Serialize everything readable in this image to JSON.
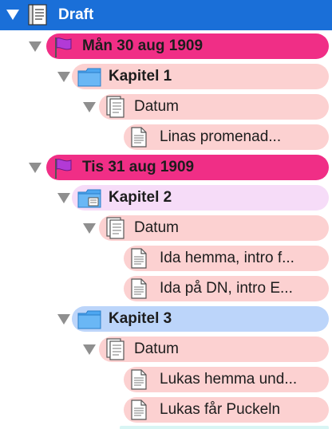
{
  "outline": {
    "root": {
      "label": "Draft"
    },
    "items": [
      {
        "label": "Mån 30 aug 1909",
        "kind": "day"
      },
      {
        "label": "Kapitel 1",
        "kind": "chapter"
      },
      {
        "label": "Datum",
        "kind": "group"
      },
      {
        "label": "Linas promenad...",
        "kind": "scene"
      },
      {
        "label": "Tis 31 aug 1909",
        "kind": "day"
      },
      {
        "label": "Kapitel 2",
        "kind": "chapter"
      },
      {
        "label": "Datum",
        "kind": "group"
      },
      {
        "label": "Ida hemma, intro f...",
        "kind": "scene"
      },
      {
        "label": "Ida på DN, intro E...",
        "kind": "scene"
      },
      {
        "label": "Kapitel 3",
        "kind": "chapter"
      },
      {
        "label": "Datum",
        "kind": "group"
      },
      {
        "label": "Lukas hemma und...",
        "kind": "scene"
      },
      {
        "label": "Lukas får Puckeln",
        "kind": "scene"
      }
    ]
  },
  "colors": {
    "selection": "#1a6fd8",
    "day_label": "#f02e86",
    "scene_label": "#fcd1d1",
    "chapter2_label": "#f6dcf8",
    "chapter3_label": "#bcd5fa"
  },
  "icons": {
    "root": "draft-notebook-icon",
    "day": "purple-flag-icon",
    "chapter": "blue-folder-icon",
    "group": "document-stack-icon",
    "scene": "document-icon"
  }
}
